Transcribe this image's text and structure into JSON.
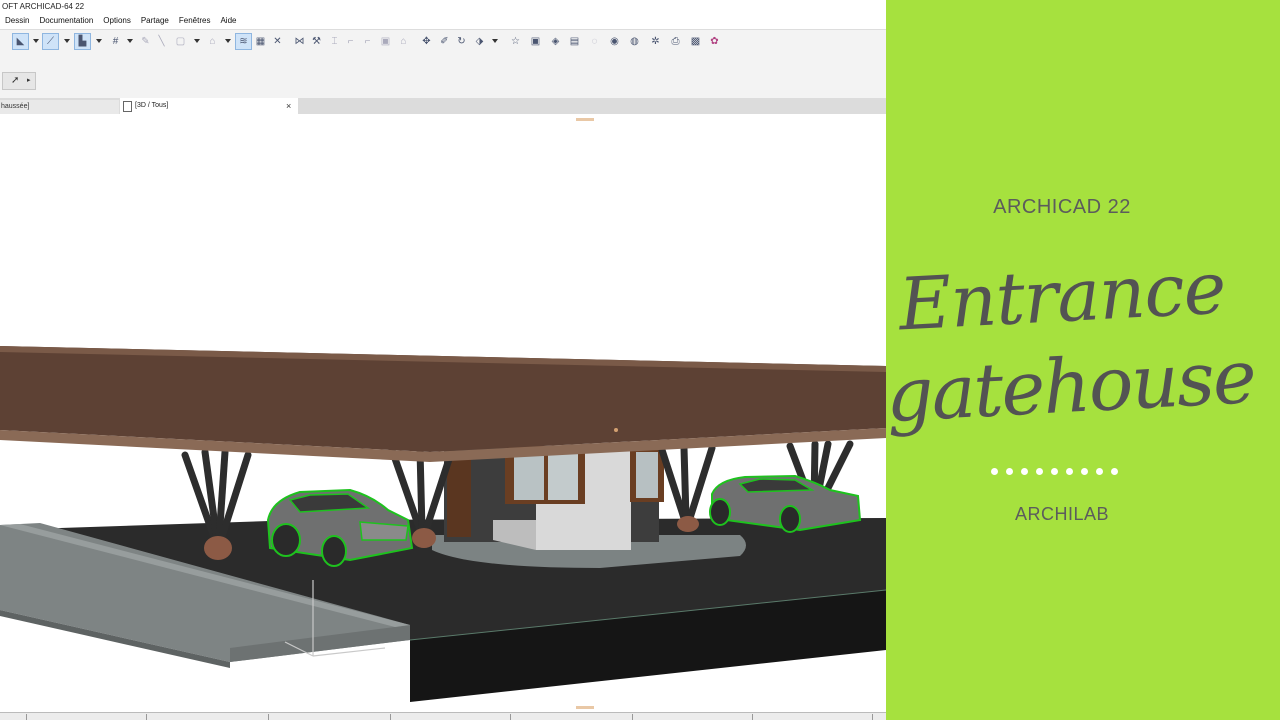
{
  "window": {
    "title": "OFT ARCHICAD-64 22"
  },
  "menu": {
    "items": [
      "Dessin",
      "Documentation",
      "Options",
      "Partage",
      "Fenêtres",
      "Aide"
    ]
  },
  "toolbar": {
    "icons": [
      "arrow-tool-icon",
      "dropdown",
      "line-tool-icon",
      "dropdown",
      "grid-snap-icon",
      "dropdown",
      "hash-grid-icon",
      "dropdown",
      "pencil-icon",
      "pen-icon",
      "rectangle-icon",
      "dropdown",
      "magic-wand-icon",
      "dropdown",
      "layers-icon",
      "table-icon",
      "cross-icon",
      "trim-icon",
      "split-icon",
      "adjust-icon",
      "fillet-icon",
      "offset-icon",
      "resize-icon",
      "home-icon",
      "move-icon",
      "edit-icon",
      "rotate-icon",
      "mirror-icon",
      "dropdown",
      "star-icon",
      "tag-icon",
      "section-icon",
      "book-icon",
      "globe-icon",
      "render-icon",
      "camera-icon",
      "lamp-icon",
      "print-icon",
      "palette-icon"
    ]
  },
  "tabs": {
    "floor": "haussée]",
    "view3d": "[3D / Tous]",
    "close": "×"
  },
  "banner": {
    "top": "ARCHICAD 22",
    "title_line1": "Entrance",
    "title_line2": "gatehouse",
    "bottom": "ARCHILAB",
    "dots": 9,
    "bg_color": "#a6e13e",
    "text_color": "#595959"
  }
}
